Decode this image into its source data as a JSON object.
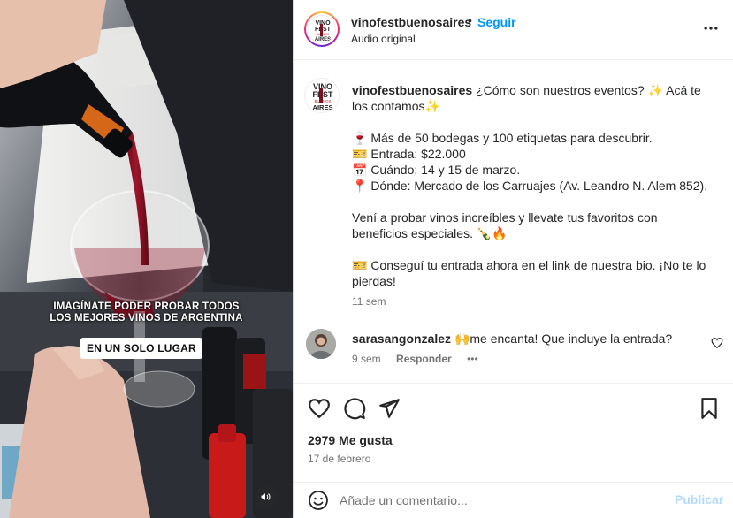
{
  "media": {
    "overlay_line1": "IMAGÍNATE PODER PROBAR TODOS",
    "overlay_line2": "LOS MEJORES VINOS DE ARGENTINA",
    "overlay_pill": "EN UN SOLO LUGAR",
    "audio_icon": "speaker-icon"
  },
  "header": {
    "username": "vinofestbuenosaires",
    "dot": "•",
    "follow_label": "Seguir",
    "audio_label": "Audio original",
    "more_icon": "more-icon"
  },
  "logo": {
    "line1": "VINO",
    "line2": "FEST",
    "line3": "BUENOS",
    "line4": "AIRES"
  },
  "caption": {
    "username": "vinofestbuenosaires",
    "intro": "¿Cómo son nuestros eventos? ✨ Acá te los contamos✨",
    "line_bodegas": "🍷 Más de 50 bodegas y 100 etiquetas para descubrir.",
    "line_entrada": "🎫 Entrada: $22.000",
    "line_cuando": "📅 Cuándo: 14 y 15 de marzo.",
    "line_donde": "📍 Dónde: Mercado de los Carruajes (Av. Leandro N. Alem 852).",
    "line_veni": "Vení a probar vinos increíbles y llevate tus favoritos con beneficios especiales. 🍾🔥",
    "line_consegui": "🎫 Conseguí tu entrada ahora en el link de nuestra bio. ¡No te lo pierdas!",
    "time": "11 sem"
  },
  "comment": {
    "username": "sarasangonzalez",
    "text": "🙌me encanta! Que incluye la entrada?",
    "time": "9 sem",
    "reply_label": "Responder",
    "more": "•••"
  },
  "actions": {
    "likes": "2979 Me gusta",
    "date": "17 de febrero"
  },
  "add_comment": {
    "placeholder": "Añade un comentario...",
    "publish_label": "Publicar"
  },
  "colors": {
    "accent": "#0095f6",
    "publish_disabled": "#b3dbff",
    "muted": "#737373",
    "wine": "#8b1020"
  }
}
